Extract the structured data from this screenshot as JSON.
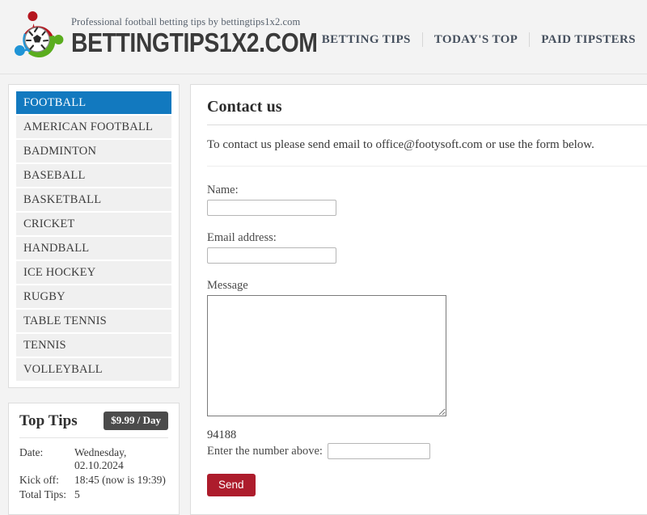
{
  "header": {
    "tagline": "Professional football betting tips by bettingtips1x2.com",
    "wordmark": "BETTINGTIPS1X2.COM",
    "nav": [
      {
        "label": "BETTING TIPS"
      },
      {
        "label": "TODAY'S TOP"
      },
      {
        "label": "PAID TIPSTERS"
      }
    ]
  },
  "sidebar": {
    "sports": [
      {
        "label": "FOOTBALL",
        "active": true
      },
      {
        "label": "AMERICAN FOOTBALL",
        "active": false
      },
      {
        "label": "BADMINTON",
        "active": false
      },
      {
        "label": "BASEBALL",
        "active": false
      },
      {
        "label": "BASKETBALL",
        "active": false
      },
      {
        "label": "CRICKET",
        "active": false
      },
      {
        "label": "HANDBALL",
        "active": false
      },
      {
        "label": "ICE HOCKEY",
        "active": false
      },
      {
        "label": "RUGBY",
        "active": false
      },
      {
        "label": "TABLE TENNIS",
        "active": false
      },
      {
        "label": "TENNIS",
        "active": false
      },
      {
        "label": "VOLLEYBALL",
        "active": false
      }
    ],
    "top_tips": {
      "title": "Top Tips",
      "price_badge": "$9.99 / Day",
      "rows": [
        {
          "key": "Date:",
          "value": "Wednesday, 02.10.2024"
        },
        {
          "key": "Kick off:",
          "value": "18:45 (now is 19:39)"
        },
        {
          "key": "Total Tips:",
          "value": "5"
        }
      ]
    }
  },
  "main": {
    "title": "Contact us",
    "intro": "To contact us please send email to office@footysoft.com or use the form below.",
    "form": {
      "name_label": "Name:",
      "name_value": "",
      "email_label": "Email address:",
      "email_value": "",
      "message_label": "Message",
      "message_value": "",
      "captcha_number": "94188",
      "captcha_label": "Enter the number above:",
      "captcha_value": "",
      "send_label": "Send"
    }
  },
  "colors": {
    "page_bg": "#f3f3f3",
    "panel_bg": "#ffffff",
    "accent_blue": "#1279bf",
    "accent_red": "#ad1c2c",
    "badge_gray": "#4b4b4b",
    "logo_red": "#b5161f",
    "logo_green": "#5aad1e",
    "logo_blue": "#1f94d6"
  }
}
